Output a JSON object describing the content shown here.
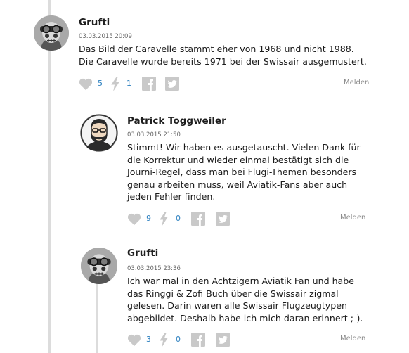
{
  "comments": [
    {
      "author": "Grufti",
      "time": "03.03.2015 20:09",
      "body_lines": [
        "Das Bild der Caravelle stammt eher von 1968 und nicht 1988.",
        "Die Caravelle wurde bereits 1971 bei der Swissair ausgemustert."
      ],
      "likes": "5",
      "flashes": "1",
      "report_label": "Melden",
      "avatar": "skull-goggles-avatar"
    },
    {
      "author": "Patrick Toggweiler",
      "time": "03.03.2015 21:50",
      "body_lines": [
        "Stimmt! Wir haben es ausgetauscht. Vielen Dank für",
        "die Korrektur und wieder einmal bestätigt sich die",
        "Journi-Regel, dass man bei Flugi-Themen besonders",
        "genau arbeiten muss, weil Aviatik-Fans aber auch",
        "jeden Fehler finden."
      ],
      "likes": "9",
      "flashes": "0",
      "report_label": "Melden",
      "avatar": "bearded-man-avatar"
    },
    {
      "author": "Grufti",
      "time": "03.03.2015 23:36",
      "body_lines": [
        "Ich war mal in den Achtzigern Aviatik Fan und habe",
        "das Ringgi & Zofi Buch über die Swissair zigmal",
        "gelesen. Darin waren alle Swissair Flugzeugtypen",
        "abgebildet. Deshalb habe ich mich daran erinnert ;-)."
      ],
      "likes": "3",
      "flashes": "0",
      "report_label": "Melden",
      "avatar": "skull-goggles-avatar"
    }
  ],
  "colors": {
    "count": "#2a7fbf",
    "icon": "#c9c9c9",
    "thread_line": "#dcdcdc",
    "meta": "#8a8a8a"
  }
}
